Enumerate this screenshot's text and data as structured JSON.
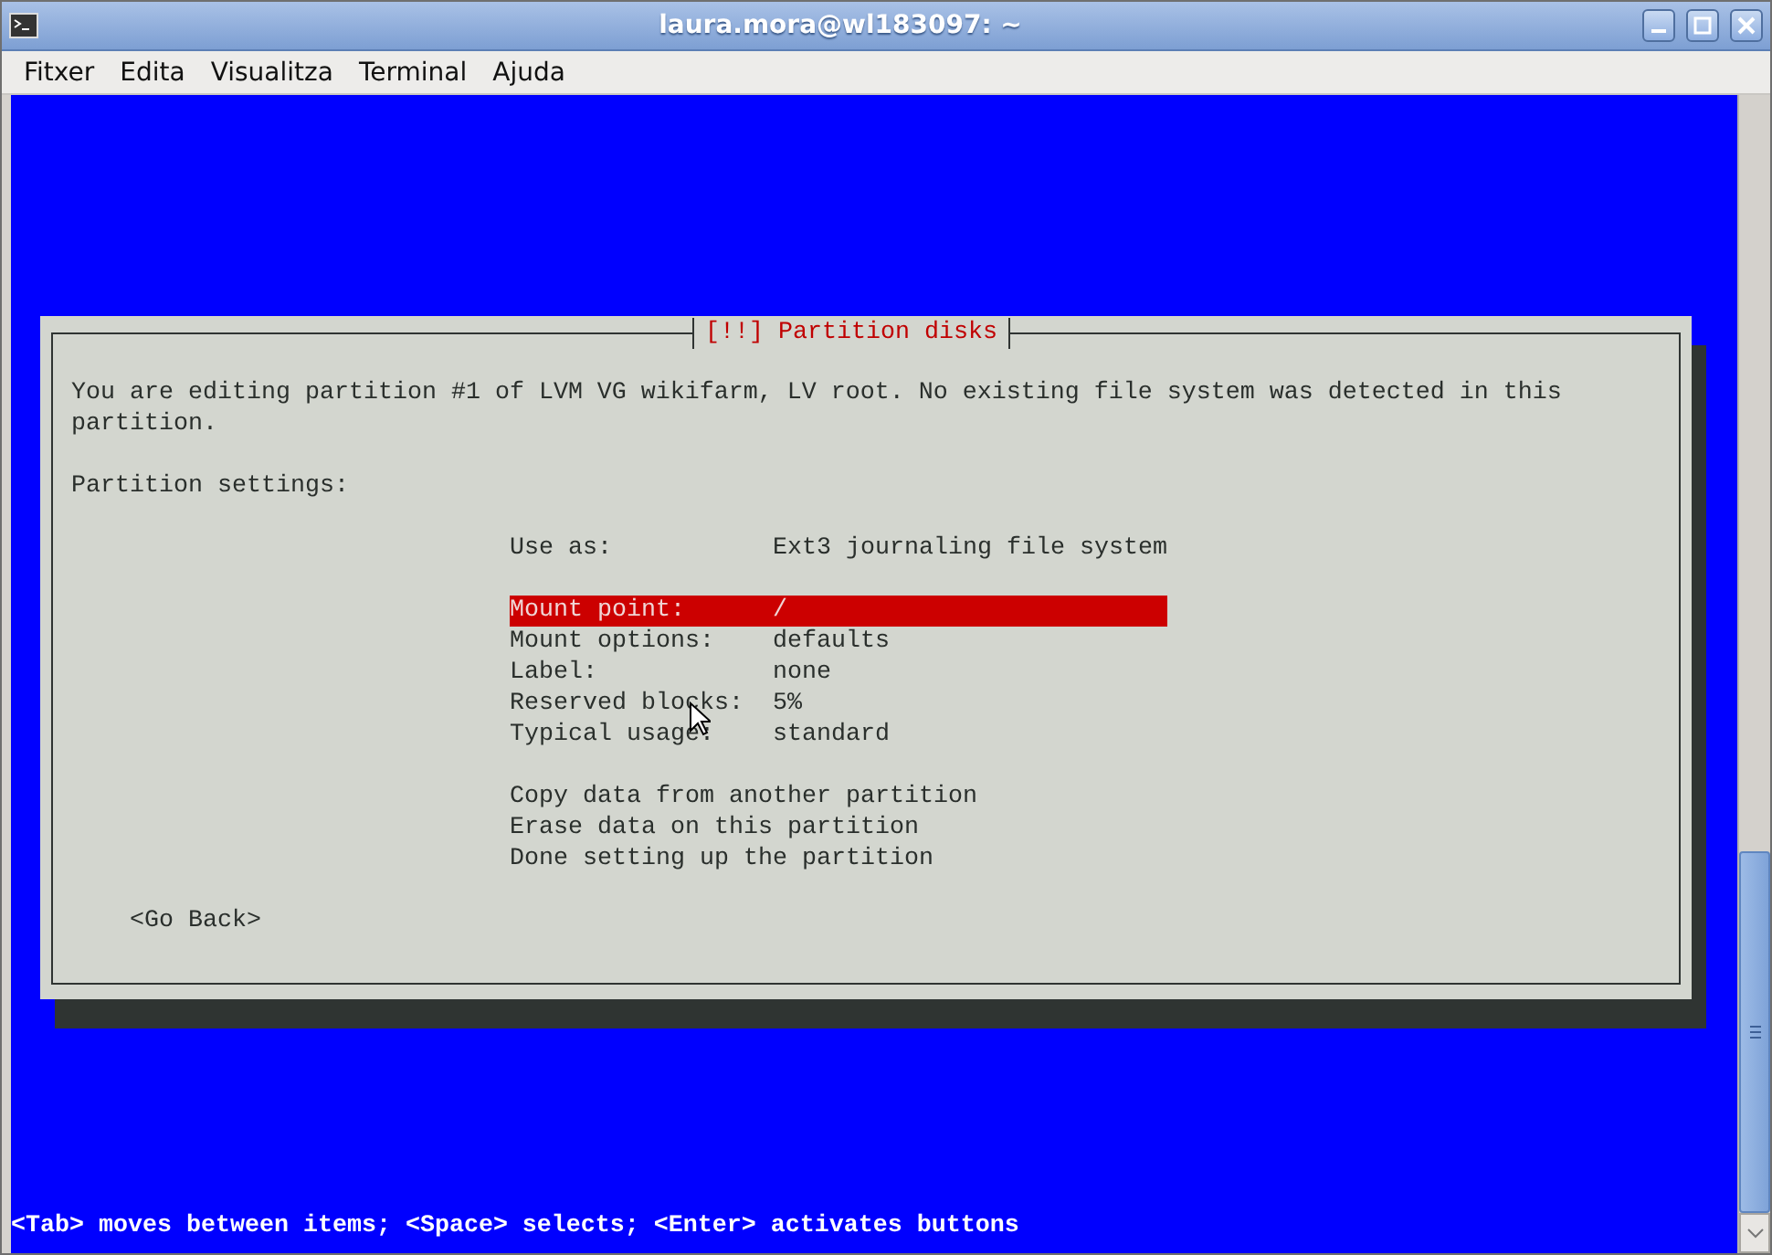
{
  "window": {
    "title": "laura.mora@wl183097: ~"
  },
  "menu": [
    "Fitxer",
    "Edita",
    "Visualitza",
    "Terminal",
    "Ajuda"
  ],
  "dialog": {
    "title": "[!!] Partition disks",
    "message": "You are editing partition #1 of LVM VG wikifarm, LV root. No existing file system was detected in this partition.",
    "section": "Partition settings:",
    "use_as": {
      "label": "Use as:",
      "value": "Ext3 journaling file system"
    },
    "settings": [
      {
        "label": "Mount point:",
        "value": "/",
        "selected": true
      },
      {
        "label": "Mount options:",
        "value": "defaults",
        "selected": false
      },
      {
        "label": "Label:",
        "value": "none",
        "selected": false
      },
      {
        "label": "Reserved blocks:",
        "value": "5%",
        "selected": false
      },
      {
        "label": "Typical usage:",
        "value": "standard",
        "selected": false
      }
    ],
    "actions": [
      {
        "label": "Copy data from another partition",
        "selected": false
      },
      {
        "label": "Erase data on this partition",
        "selected": false
      },
      {
        "label": "Done setting up the partition",
        "selected": false
      }
    ],
    "back_button": "<Go Back>"
  },
  "status_line": "<Tab> moves between items; <Space> selects; <Enter> activates buttons"
}
